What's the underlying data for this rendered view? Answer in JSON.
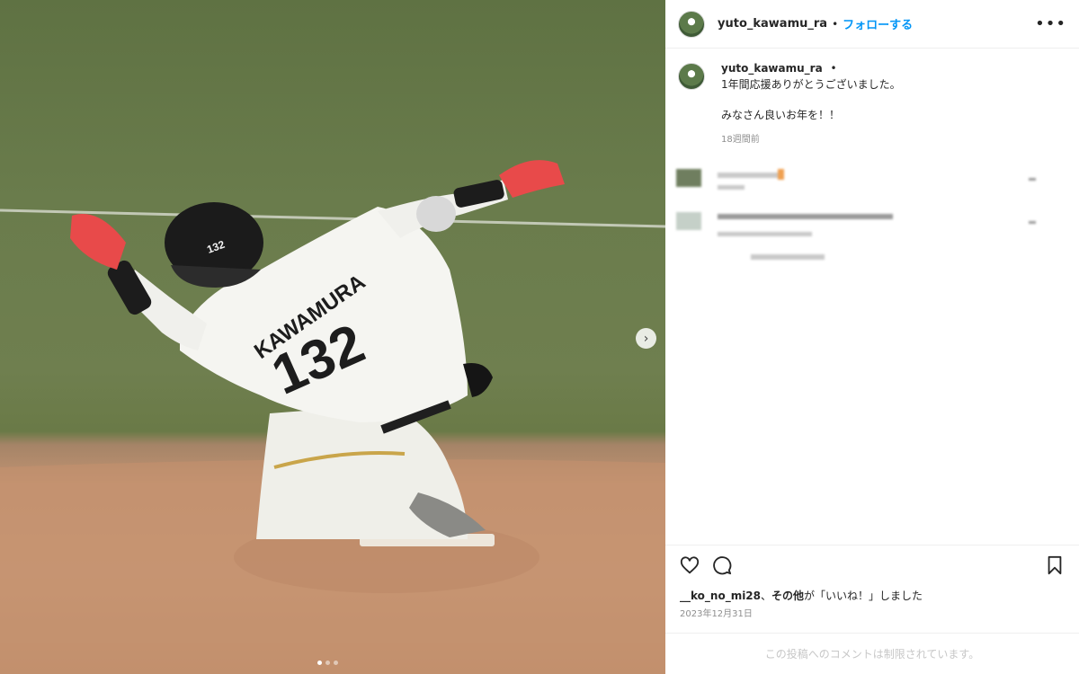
{
  "post": {
    "username": "yuto_kawamu_ra",
    "separator": "•",
    "follow_label": "フォローする",
    "more_icon": "more-horizontal-icon",
    "caption_lines": "1年間応援ありがとうございました。\n\nみなさん良いお年を！！",
    "caption_time": "18週間前",
    "photo": {
      "jersey_name": "KAWAMURA",
      "jersey_number": "132",
      "helmet_number": "132"
    },
    "carousel_next_icon": "chevron-right-icon"
  },
  "actions": {
    "like_icon": "heart-icon",
    "comment_icon": "comment-icon",
    "save_icon": "bookmark-icon"
  },
  "likes": {
    "user": "__ko_no_mi28",
    "sep": "、",
    "others": "その他",
    "suffix": "が「いいね！」しました"
  },
  "date": "2023年12月31日",
  "comments_restricted": "この投稿へのコメントは制限されています。",
  "colors": {
    "accent": "#0095f6",
    "text": "#262626",
    "muted": "#8e8e8e"
  }
}
